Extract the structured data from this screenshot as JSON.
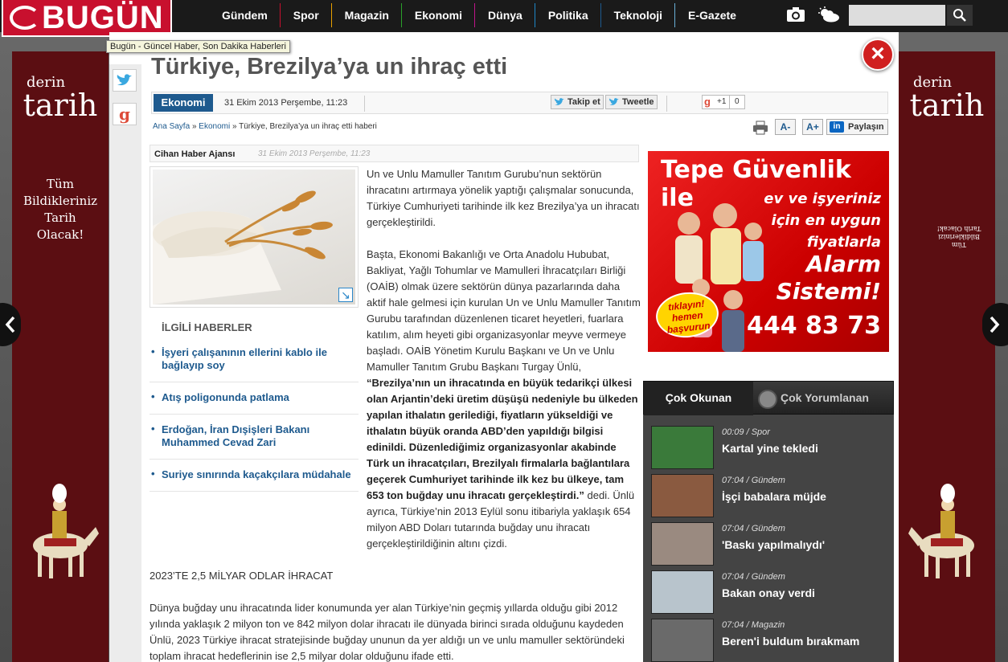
{
  "site": {
    "logo_text": "BUGÜN",
    "tooltip": "Bugün - Güncel Haber, Son Dakika Haberleri"
  },
  "nav": [
    {
      "label": "Gündem",
      "color": "#c8102e"
    },
    {
      "label": "Spor",
      "color": "#e8a000"
    },
    {
      "label": "Magazin",
      "color": "#2aa02a"
    },
    {
      "label": "Ekonomi",
      "color": "#c0158a"
    },
    {
      "label": "Dünya",
      "color": "#1e88c8"
    },
    {
      "label": "Politika",
      "color": "#1e5a8e"
    },
    {
      "label": "Teknoloji",
      "color": "#6ab0d8"
    },
    {
      "label": "E-Gazete",
      "color": "#e8a000"
    }
  ],
  "search": {
    "placeholder": "",
    "value": ""
  },
  "article": {
    "title": "Türkiye, Brezilya’ya un ihraç etti",
    "category": "Ekonomi",
    "date": "31 Ekim 2013 Perşembe, 11:23",
    "follow_label": "Takip et",
    "tweet_label": "Tweetle",
    "gplus_label": "+1",
    "gplus_count": "0",
    "breadcrumb": [
      "Ana Sayfa",
      "Ekonomi",
      "Türkiye, Brezilya’ya un ihraç etti haberi"
    ],
    "breadcrumb_sep": "»",
    "font_minus": "A-",
    "font_plus": "A+",
    "share_label": "Paylaşın",
    "source": "Cihan Haber Ajansı",
    "source_date": "31 Ekim 2013 Perşembe, 11:23",
    "p1": "Un ve Unlu Mamuller Tanıtım Gurubu’nun sektörün ihracatını artırmaya yönelik yaptığı çalışmalar sonucunda, Türkiye Cumhuriyeti tarihinde ilk kez Brezilya’ya un ihracatı gerçekleştirildi.",
    "p2a": "Başta, Ekonomi Bakanlığı ve Orta Anadolu Hububat, Bakliyat, Yağlı Tohumlar ve Mamulleri İhracatçıları Birliği (OAİB) olmak üzere sektörün dünya pazarlarında daha aktif hale gelmesi için kurulan Un ve Unlu Mamuller Tanıtım Gurubu tarafından düzenlenen ticaret heyetleri, fuarlara katılım, alım heyeti gibi organizasyonlar meyve vermeye başladı. OAİB Yönetim Kurulu Başkanı ve Un ve Unlu Mamuller Tanıtım Grubu Başkanı Turgay Ünlü,",
    "p2_quote": "“Brezilya’nın un ihracatında en büyük tedarikçi ülkesi olan Arjantin’deki üretim düşüşü nedeniyle bu ülkeden yapılan ithalatın gerilediği, fiyatların yükseldiği ve ithalatın büyük oranda ABD’den yapıldığı bilgisi edinildi. Düzenlediğimiz organizasyonlar akabinde Türk un ihracatçıları, Brezilyalı firmalarla bağlantılara geçerek Cumhuriyet tarihinde ilk kez bu ülkeye, tam 653 ton buğday unu ihracatı gerçekleştirdi.”",
    "p2b": " dedi. Ünlü ayrıca, Türkiye’nin 2013 Eylül sonu itibariyla yaklaşık 654 milyon ABD Doları tutarında buğday unu ihracatı gerçekleştirildiğinin altını çizdi.",
    "subhead": "2023’TE 2,5 MİLYAR ODLAR İHRACAT",
    "p3": "Dünya buğday unu ihracatında lider konumunda yer alan Türkiye’nin geçmiş yıllarda olduğu gibi 2012 yılında yaklaşık 2 milyon ton ve 842 milyon dolar ihracatı ile dünyada birinci sırada olduğunu kaydeden Ünlü, 2023 Türkiye ihracat stratejisinde buğday ununun da yer aldığı un ve unlu mamuller sektöründeki toplam ihracat hedeflerinin ise 2,5 milyar dolar olduğunu ifade etti."
  },
  "related": {
    "title": "İLGİLİ HABERLER",
    "items": [
      "İşyeri çalışanının ellerini kablo ile bağlayıp soy",
      "Atış poligonunda patlama",
      "Erdoğan, İran Dışişleri Bakanı Muhammed Cevad Zari",
      "Suriye sınırında kaçakçılara müdahale"
    ]
  },
  "side_ads": {
    "brand_small": "derin",
    "brand_big": "tarih",
    "tagline": "Tüm Bildiklerinizi Tarih Olacak!",
    "tagline_lines": [
      "Tüm",
      "Bildikleriniz",
      "Tarih",
      "Olacak!"
    ],
    "color": "#5b0e12"
  },
  "ad_mid": {
    "line1": "Tepe Güvenlik ile",
    "line2": "ev ve işyeriniz için en uygun fiyatlarla",
    "line3a": "Alarm",
    "line3b": "Sistemi!",
    "phone": "444 83 73",
    "cta": "tıklayın! hemen başvurun"
  },
  "popular": {
    "tab_active": "Çok Okunan",
    "tab_other": "Çok Yorumlanan",
    "items": [
      {
        "meta": "00:09 / Spor",
        "title": "Kartal yine tekledi",
        "thumb": "#3a7a3a"
      },
      {
        "meta": "07:04 / Gündem",
        "title": "İşçi babalara müjde",
        "thumb": "#8a5a40"
      },
      {
        "meta": "07:04 / Gündem",
        "title": "'Baskı yapılmalıydı'",
        "thumb": "#9a8a80"
      },
      {
        "meta": "07:04 / Gündem",
        "title": "Bakan onay verdi",
        "thumb": "#b8c4cc"
      },
      {
        "meta": "07:04 / Magazin",
        "title": "Beren'i buldum bırakmam",
        "thumb": "#6a6a6a"
      }
    ]
  }
}
